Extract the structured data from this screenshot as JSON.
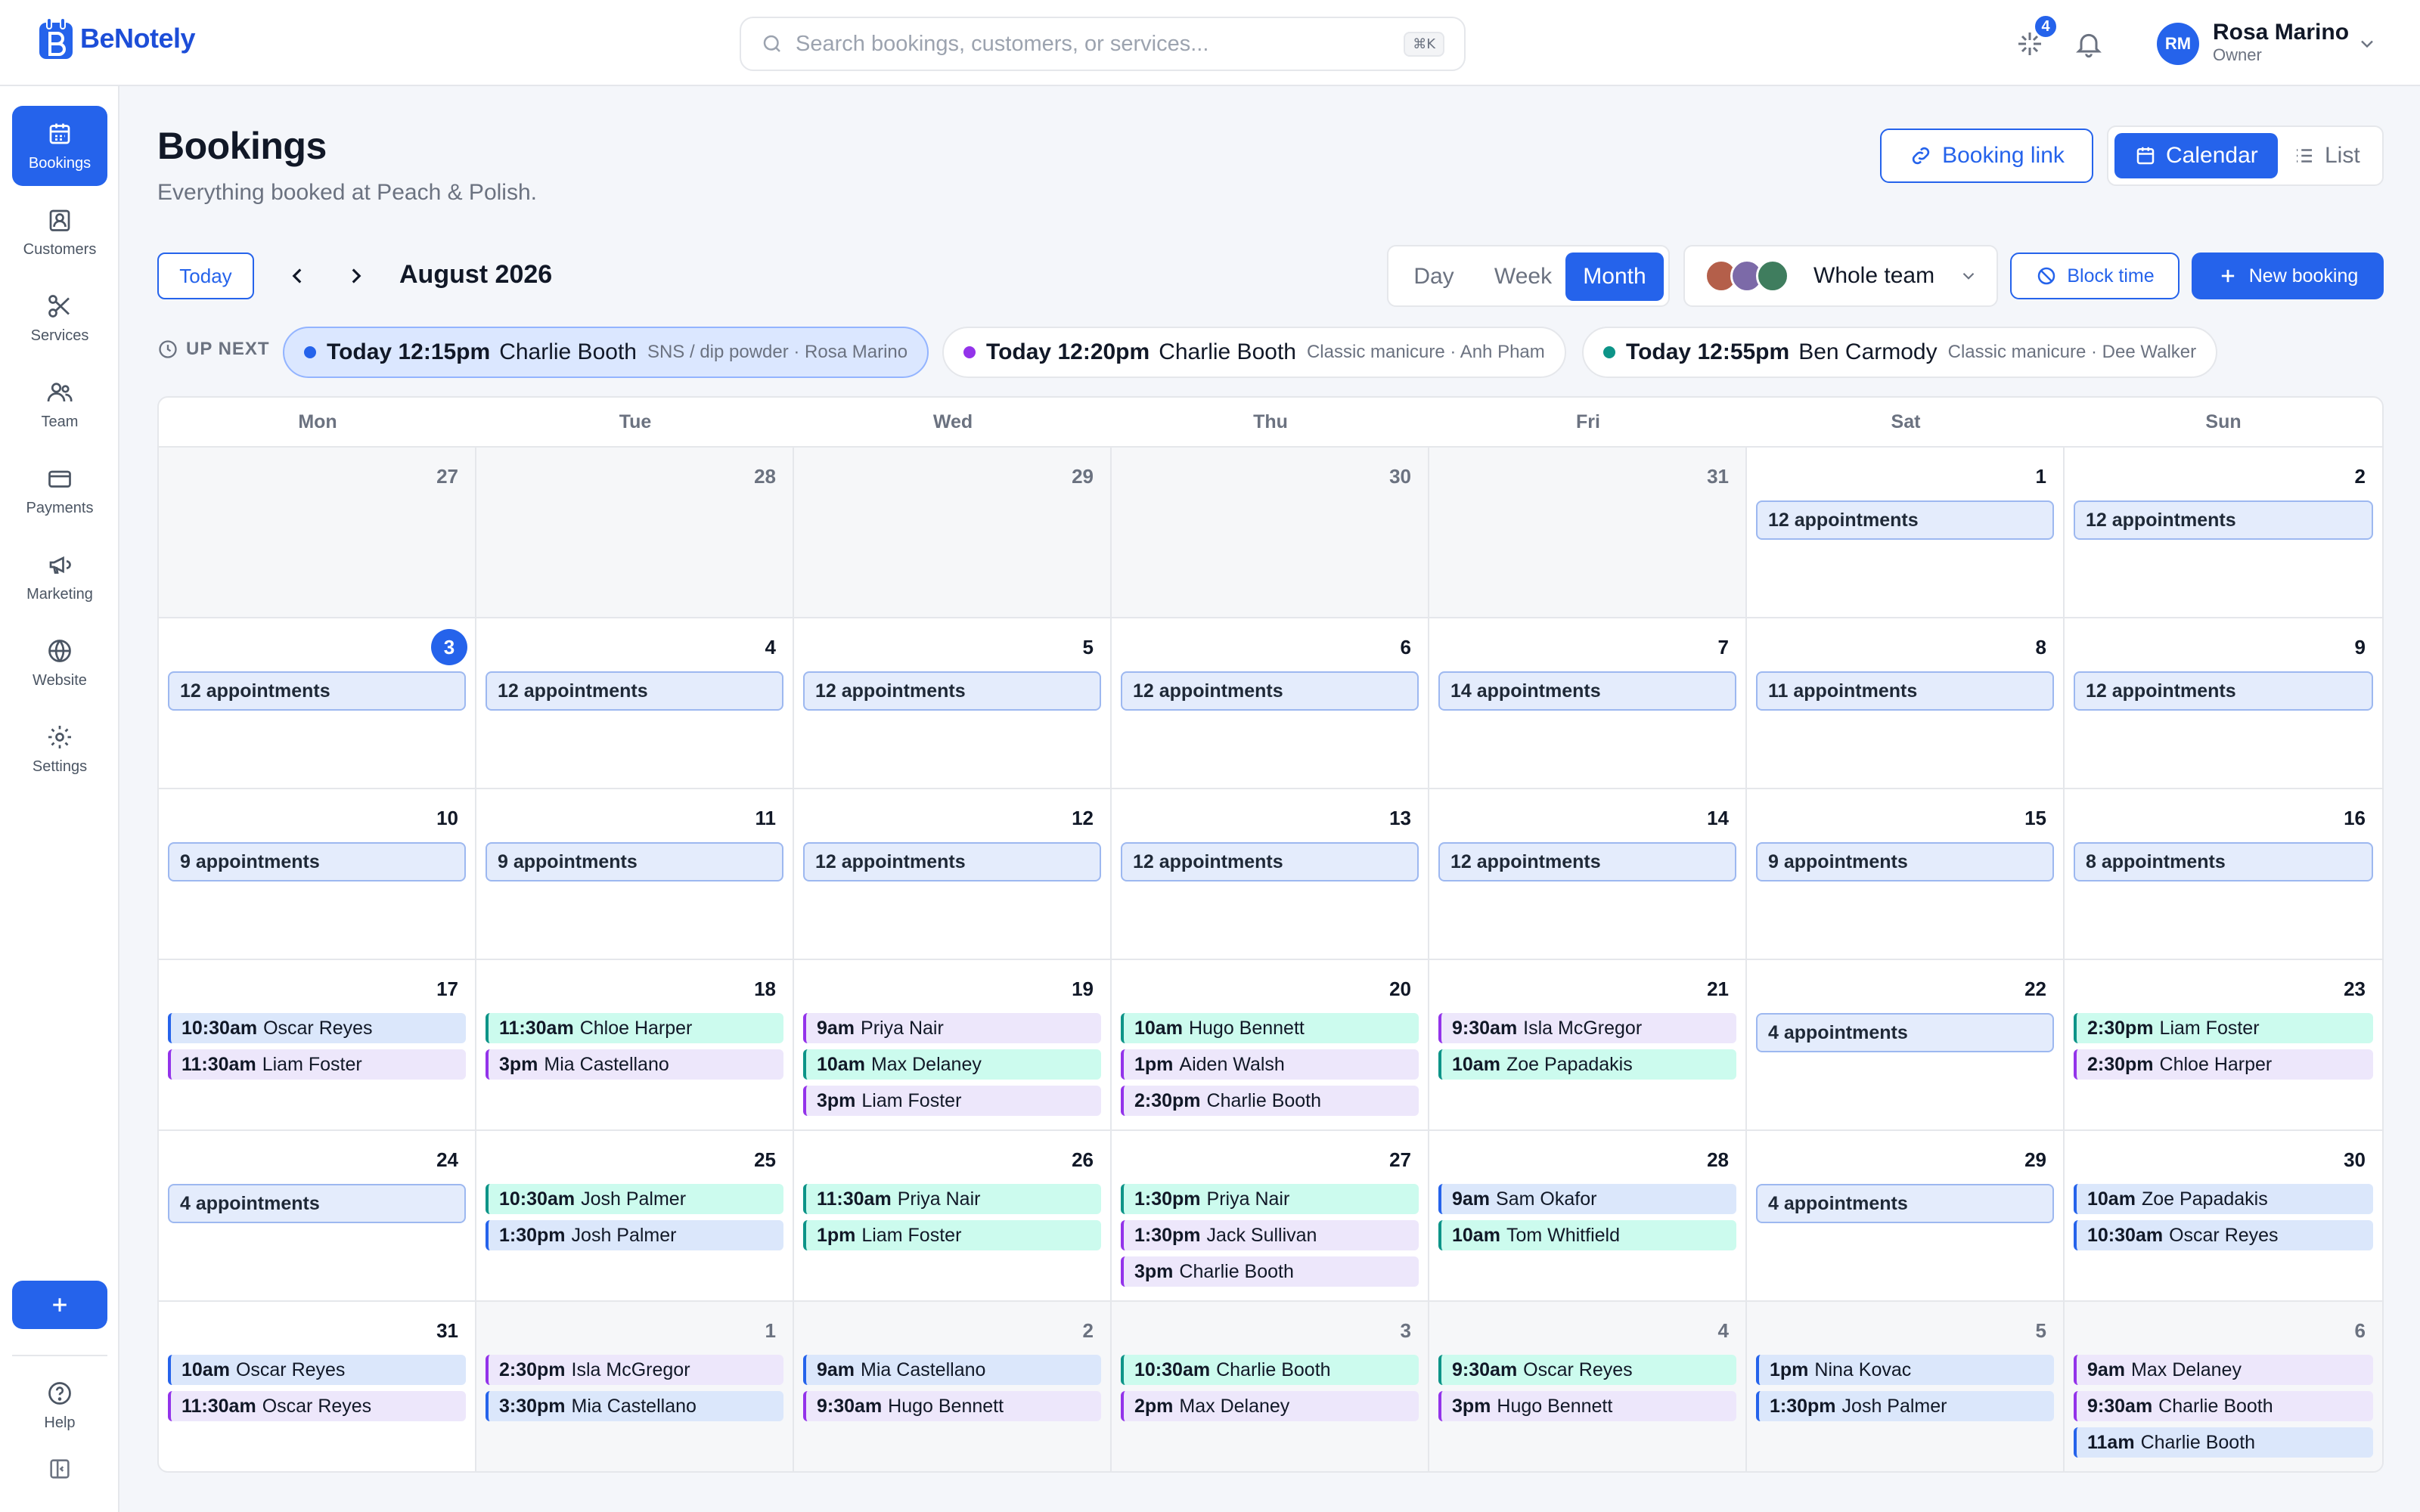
{
  "app": {
    "name": "BeNotely"
  },
  "search": {
    "placeholder": "Search bookings, customers, or services...",
    "shortcut": "⌘K"
  },
  "notifications": {
    "badge": "4"
  },
  "user": {
    "initials": "RM",
    "name": "Rosa Marino",
    "role": "Owner"
  },
  "sidebar": {
    "items": [
      {
        "label": "Bookings",
        "icon": "calendar-icon",
        "active": true
      },
      {
        "label": "Customers",
        "icon": "customer-badge-icon"
      },
      {
        "label": "Services",
        "icon": "scissors-icon"
      },
      {
        "label": "Team",
        "icon": "team-icon"
      },
      {
        "label": "Payments",
        "icon": "card-icon"
      },
      {
        "label": "Marketing",
        "icon": "megaphone-icon"
      },
      {
        "label": "Website",
        "icon": "globe-icon"
      },
      {
        "label": "Settings",
        "icon": "gear-icon"
      }
    ],
    "help": "Help"
  },
  "header": {
    "title": "Bookings",
    "subtitle": "Everything booked at Peach & Polish.",
    "booking_link": "Booking link",
    "view_calendar": "Calendar",
    "view_list": "List"
  },
  "toolbar": {
    "today": "Today",
    "month_label": "August 2026",
    "range": [
      "Day",
      "Week",
      "Month"
    ],
    "active_range": "Month",
    "team": "Whole team",
    "block_time": "Block time",
    "new_booking": "New booking"
  },
  "up_next": {
    "label": "UP NEXT",
    "items": [
      {
        "time": "Today 12:15pm",
        "name": "Charlie Booth",
        "meta": "SNS / dip powder · Rosa Marino",
        "color": "#2563eb"
      },
      {
        "time": "Today 12:20pm",
        "name": "Charlie Booth",
        "meta": "Classic manicure · Anh Pham",
        "color": "#9333ea"
      },
      {
        "time": "Today 12:55pm",
        "name": "Ben Carmody",
        "meta": "Classic manicure · Dee Walker",
        "color": "#0d9488"
      }
    ]
  },
  "calendar": {
    "weekdays": [
      "Mon",
      "Tue",
      "Wed",
      "Thu",
      "Fri",
      "Sat",
      "Sun"
    ],
    "weeks": [
      [
        {
          "day": "27",
          "muted": true
        },
        {
          "day": "28",
          "muted": true
        },
        {
          "day": "29",
          "muted": true
        },
        {
          "day": "30",
          "muted": true
        },
        {
          "day": "31",
          "muted": true
        },
        {
          "day": "1",
          "count": "12 appointments"
        },
        {
          "day": "2",
          "count": "12 appointments"
        }
      ],
      [
        {
          "day": "3",
          "today": true,
          "count": "12 appointments"
        },
        {
          "day": "4",
          "count": "12 appointments"
        },
        {
          "day": "5",
          "count": "12 appointments"
        },
        {
          "day": "6",
          "count": "12 appointments"
        },
        {
          "day": "7",
          "count": "14 appointments"
        },
        {
          "day": "8",
          "count": "11 appointments"
        },
        {
          "day": "9",
          "count": "12 appointments"
        }
      ],
      [
        {
          "day": "10",
          "count": "9 appointments"
        },
        {
          "day": "11",
          "count": "9 appointments"
        },
        {
          "day": "12",
          "count": "12 appointments"
        },
        {
          "day": "13",
          "count": "12 appointments"
        },
        {
          "day": "14",
          "count": "12 appointments"
        },
        {
          "day": "15",
          "count": "9 appointments"
        },
        {
          "day": "16",
          "count": "8 appointments"
        }
      ],
      [
        {
          "day": "17",
          "appts": [
            {
              "time": "10:30am",
              "name": "Oscar Reyes",
              "color": "blue"
            },
            {
              "time": "11:30am",
              "name": "Liam Foster",
              "color": "purple"
            }
          ]
        },
        {
          "day": "18",
          "appts": [
            {
              "time": "11:30am",
              "name": "Chloe Harper",
              "color": "teal"
            },
            {
              "time": "3pm",
              "name": "Mia Castellano",
              "color": "purple"
            }
          ]
        },
        {
          "day": "19",
          "appts": [
            {
              "time": "9am",
              "name": "Priya Nair",
              "color": "purple"
            },
            {
              "time": "10am",
              "name": "Max Delaney",
              "color": "teal"
            },
            {
              "time": "3pm",
              "name": "Liam Foster",
              "color": "purple"
            }
          ]
        },
        {
          "day": "20",
          "appts": [
            {
              "time": "10am",
              "name": "Hugo Bennett",
              "color": "teal"
            },
            {
              "time": "1pm",
              "name": "Aiden Walsh",
              "color": "purple"
            },
            {
              "time": "2:30pm",
              "name": "Charlie Booth",
              "color": "purple"
            }
          ]
        },
        {
          "day": "21",
          "appts": [
            {
              "time": "9:30am",
              "name": "Isla McGregor",
              "color": "purple"
            },
            {
              "time": "10am",
              "name": "Zoe Papadakis",
              "color": "teal"
            }
          ]
        },
        {
          "day": "22",
          "count": "4 appointments"
        },
        {
          "day": "23",
          "appts": [
            {
              "time": "2:30pm",
              "name": "Liam Foster",
              "color": "teal"
            },
            {
              "time": "2:30pm",
              "name": "Chloe Harper",
              "color": "purple"
            }
          ]
        }
      ],
      [
        {
          "day": "24",
          "count": "4 appointments"
        },
        {
          "day": "25",
          "appts": [
            {
              "time": "10:30am",
              "name": "Josh Palmer",
              "color": "teal"
            },
            {
              "time": "1:30pm",
              "name": "Josh Palmer",
              "color": "blue"
            }
          ]
        },
        {
          "day": "26",
          "appts": [
            {
              "time": "11:30am",
              "name": "Priya Nair",
              "color": "teal"
            },
            {
              "time": "1pm",
              "name": "Liam Foster",
              "color": "teal"
            }
          ]
        },
        {
          "day": "27",
          "appts": [
            {
              "time": "1:30pm",
              "name": "Priya Nair",
              "color": "teal"
            },
            {
              "time": "1:30pm",
              "name": "Jack Sullivan",
              "color": "purple"
            },
            {
              "time": "3pm",
              "name": "Charlie Booth",
              "color": "purple"
            }
          ]
        },
        {
          "day": "28",
          "appts": [
            {
              "time": "9am",
              "name": "Sam Okafor",
              "color": "blue"
            },
            {
              "time": "10am",
              "name": "Tom Whitfield",
              "color": "teal"
            }
          ]
        },
        {
          "day": "29",
          "count": "4 appointments"
        },
        {
          "day": "30",
          "appts": [
            {
              "time": "10am",
              "name": "Zoe Papadakis",
              "color": "blue"
            },
            {
              "time": "10:30am",
              "name": "Oscar Reyes",
              "color": "blue"
            }
          ]
        }
      ],
      [
        {
          "day": "31",
          "appts": [
            {
              "time": "10am",
              "name": "Oscar Reyes",
              "color": "blue"
            },
            {
              "time": "11:30am",
              "name": "Oscar Reyes",
              "color": "purple"
            }
          ]
        },
        {
          "day": "1",
          "muted": true,
          "appts": [
            {
              "time": "2:30pm",
              "name": "Isla McGregor",
              "color": "purple"
            },
            {
              "time": "3:30pm",
              "name": "Mia Castellano",
              "color": "blue"
            }
          ]
        },
        {
          "day": "2",
          "muted": true,
          "appts": [
            {
              "time": "9am",
              "name": "Mia Castellano",
              "color": "blue"
            },
            {
              "time": "9:30am",
              "name": "Hugo Bennett",
              "color": "purple"
            }
          ]
        },
        {
          "day": "3",
          "muted": true,
          "appts": [
            {
              "time": "10:30am",
              "name": "Charlie Booth",
              "color": "teal"
            },
            {
              "time": "2pm",
              "name": "Max Delaney",
              "color": "purple"
            }
          ]
        },
        {
          "day": "4",
          "muted": true,
          "appts": [
            {
              "time": "9:30am",
              "name": "Oscar Reyes",
              "color": "teal"
            },
            {
              "time": "3pm",
              "name": "Hugo Bennett",
              "color": "purple"
            }
          ]
        },
        {
          "day": "5",
          "muted": true,
          "appts": [
            {
              "time": "1pm",
              "name": "Nina Kovac",
              "color": "blue"
            },
            {
              "time": "1:30pm",
              "name": "Josh Palmer",
              "color": "blue"
            }
          ]
        },
        {
          "day": "6",
          "muted": true,
          "appts": [
            {
              "time": "9am",
              "name": "Max Delaney",
              "color": "purple"
            },
            {
              "time": "9:30am",
              "name": "Charlie Booth",
              "color": "purple"
            },
            {
              "time": "11am",
              "name": "Charlie Booth",
              "color": "blue"
            }
          ]
        }
      ]
    ]
  }
}
